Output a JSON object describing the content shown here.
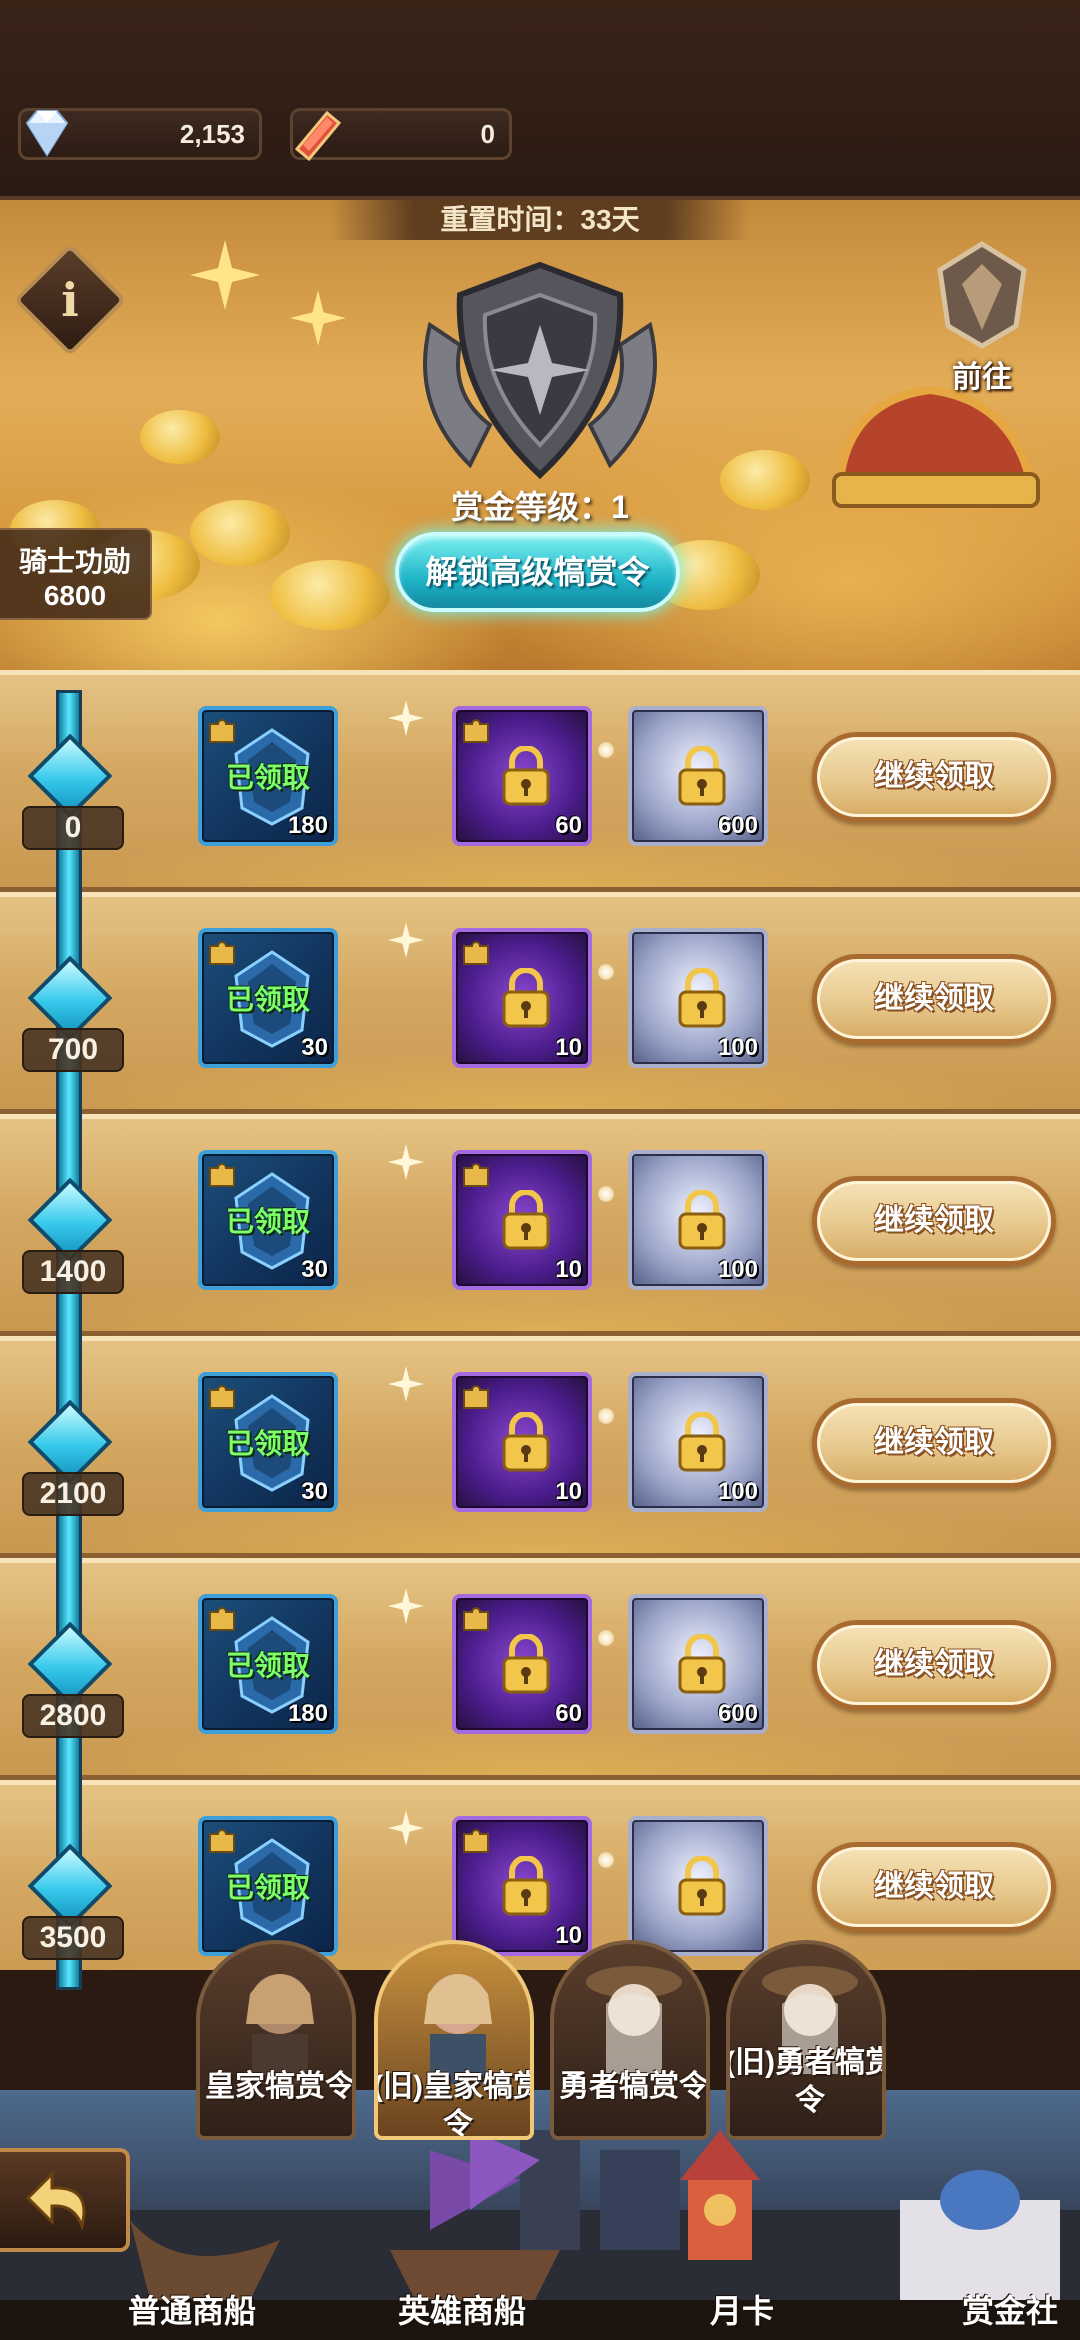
{
  "currencies": [
    {
      "icon": "diamond-icon",
      "value": "2,153"
    },
    {
      "icon": "red-crystal-icon",
      "value": "0"
    }
  ],
  "banner": {
    "reset_text": "重置时间：33天",
    "goto_label": "前往",
    "level_text": "赏金等级：1",
    "unlock_label": "解锁高级犒赏令",
    "merit_label": "骑士功勋",
    "merit_value": "6800"
  },
  "colors": {
    "accent_cyan": "#2fc8dc",
    "claimed_green": "#7dff6a",
    "panel_gold": "#d4a862"
  },
  "rows": [
    {
      "milestone": "0",
      "free": {
        "status": "已领取",
        "count": "180"
      },
      "premium": {
        "count": "60"
      },
      "elite": {
        "count": "600"
      },
      "button": "继续领取"
    },
    {
      "milestone": "700",
      "free": {
        "status": "已领取",
        "count": "30"
      },
      "premium": {
        "count": "10"
      },
      "elite": {
        "count": "100"
      },
      "button": "继续领取"
    },
    {
      "milestone": "1400",
      "free": {
        "status": "已领取",
        "count": "30"
      },
      "premium": {
        "count": "10"
      },
      "elite": {
        "count": "100"
      },
      "button": "继续领取"
    },
    {
      "milestone": "2100",
      "free": {
        "status": "已领取",
        "count": "30"
      },
      "premium": {
        "count": "10"
      },
      "elite": {
        "count": "100"
      },
      "button": "继续领取"
    },
    {
      "milestone": "2800",
      "free": {
        "status": "已领取",
        "count": "180"
      },
      "premium": {
        "count": "60"
      },
      "elite": {
        "count": "600"
      },
      "button": "继续领取"
    },
    {
      "milestone": "3500",
      "free": {
        "status": "已领取",
        "count": ""
      },
      "premium": {
        "count": "10"
      },
      "elite": {
        "count": ""
      },
      "button": "继续领取"
    }
  ],
  "hero_tabs": [
    {
      "label": "皇家犒赏令"
    },
    {
      "label": "(旧)皇家犒赏令"
    },
    {
      "label": "勇者犒赏令"
    },
    {
      "label": "(旧)勇者犒赏令"
    }
  ],
  "bottom_nav": [
    {
      "label": "普通商船"
    },
    {
      "label": "英雄商船"
    },
    {
      "label": "月卡"
    },
    {
      "label": "赏金社"
    }
  ]
}
